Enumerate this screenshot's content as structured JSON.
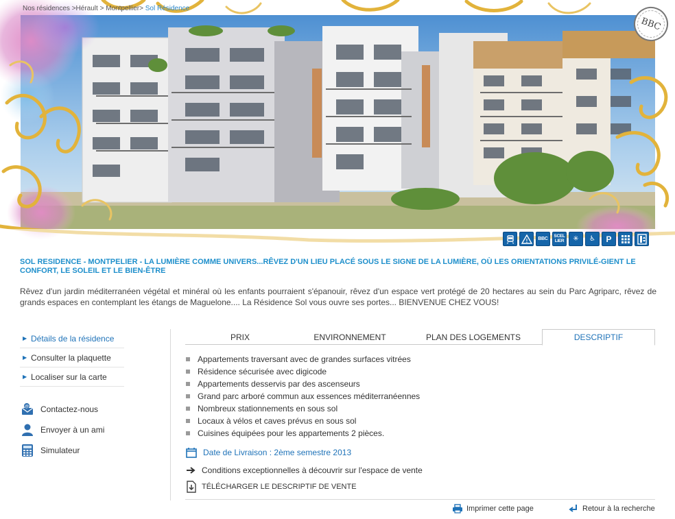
{
  "breadcrumb": {
    "items": [
      "Nos résidences",
      "Hérault",
      "Montpellier",
      "Sol Résidence"
    ],
    "separators": [
      " >",
      " >",
      ">"
    ]
  },
  "hero": {
    "badge": "BBC",
    "features": [
      {
        "icon": "tram-icon",
        "label": ""
      },
      {
        "icon": "warning-icon",
        "label": "!"
      },
      {
        "icon": "bbc-icon",
        "label": "BBC"
      },
      {
        "icon": "scellier-icon",
        "label": "SCEL LIER"
      },
      {
        "icon": "sun-icon",
        "label": "✳"
      },
      {
        "icon": "accessibility-icon",
        "label": "♿"
      },
      {
        "icon": "parking-icon",
        "label": "P"
      },
      {
        "icon": "digicode-icon",
        "label": ""
      },
      {
        "icon": "elevator-icon",
        "label": ""
      }
    ],
    "accent": "#e2b33b"
  },
  "headline": "SOL RESIDENCE - MONTPELIER - LA LUMIÈRE COMME UNIVERS...RÊVEZ D'UN LIEU PLACÉ SOUS LE SIGNE DE LA LUMIÈRE, OÙ LES ORIENTATIONS PRIVILÉ-GIENT LE CONFORT, LE SOLEIL ET LE BIEN-ÊTRE",
  "intro": "Rêvez d'un jardin méditerranéen végétal et minéral où les enfants pourraient s'épanouir, rêvez d'un espace vert protégé de 20 hectares au sein du Parc Agriparc, rêvez de grands espaces en contemplant les étangs de Maguelone.... La Résidence Sol vous ouvre ses portes... BIENVENUE CHEZ VOUS!",
  "leftnav": {
    "items": [
      {
        "label": "Détails de la résidence",
        "active": true
      },
      {
        "label": "Consulter la plaquette",
        "active": false
      },
      {
        "label": "Localiser sur la carte",
        "active": false
      }
    ]
  },
  "contacts": [
    {
      "label": "Contactez-nous",
      "icon": "contact-icon"
    },
    {
      "label": "Envoyer à un ami",
      "icon": "person-icon"
    },
    {
      "label": "Simulateur",
      "icon": "calculator-icon"
    }
  ],
  "tabs": [
    {
      "label": "PRIX"
    },
    {
      "label": "ENVIRONNEMENT"
    },
    {
      "label": "PLAN DES LOGEMENTS"
    },
    {
      "label": "DESCRIPTIF",
      "active": true
    }
  ],
  "descriptif": [
    "Appartements traversant avec de grandes surfaces vitrées",
    "Résidence sécurisée avec digicode",
    "Appartements desservis par des ascenseurs",
    "Grand parc arboré commun aux essences méditerranéennes",
    "Nombreux stationnements en sous sol",
    "Locaux à vélos et caves prévus en sous sol",
    "Cuisines équipées pour les appartements 2 pièces."
  ],
  "delivery": "Date de Livraison : 2ème semestre 2013",
  "conditions": "Conditions exceptionnelles à découvrir sur l'espace de vente",
  "download": "TÉLÉCHARGER LE DESCRIPTIF DE VENTE",
  "footer": {
    "print": "Imprimer cette page",
    "back": "Retour à la recherche"
  },
  "colors": {
    "link_blue": "#1e72b8",
    "headline_blue": "#1e8fcb",
    "feature_blue": "#1565a9"
  }
}
